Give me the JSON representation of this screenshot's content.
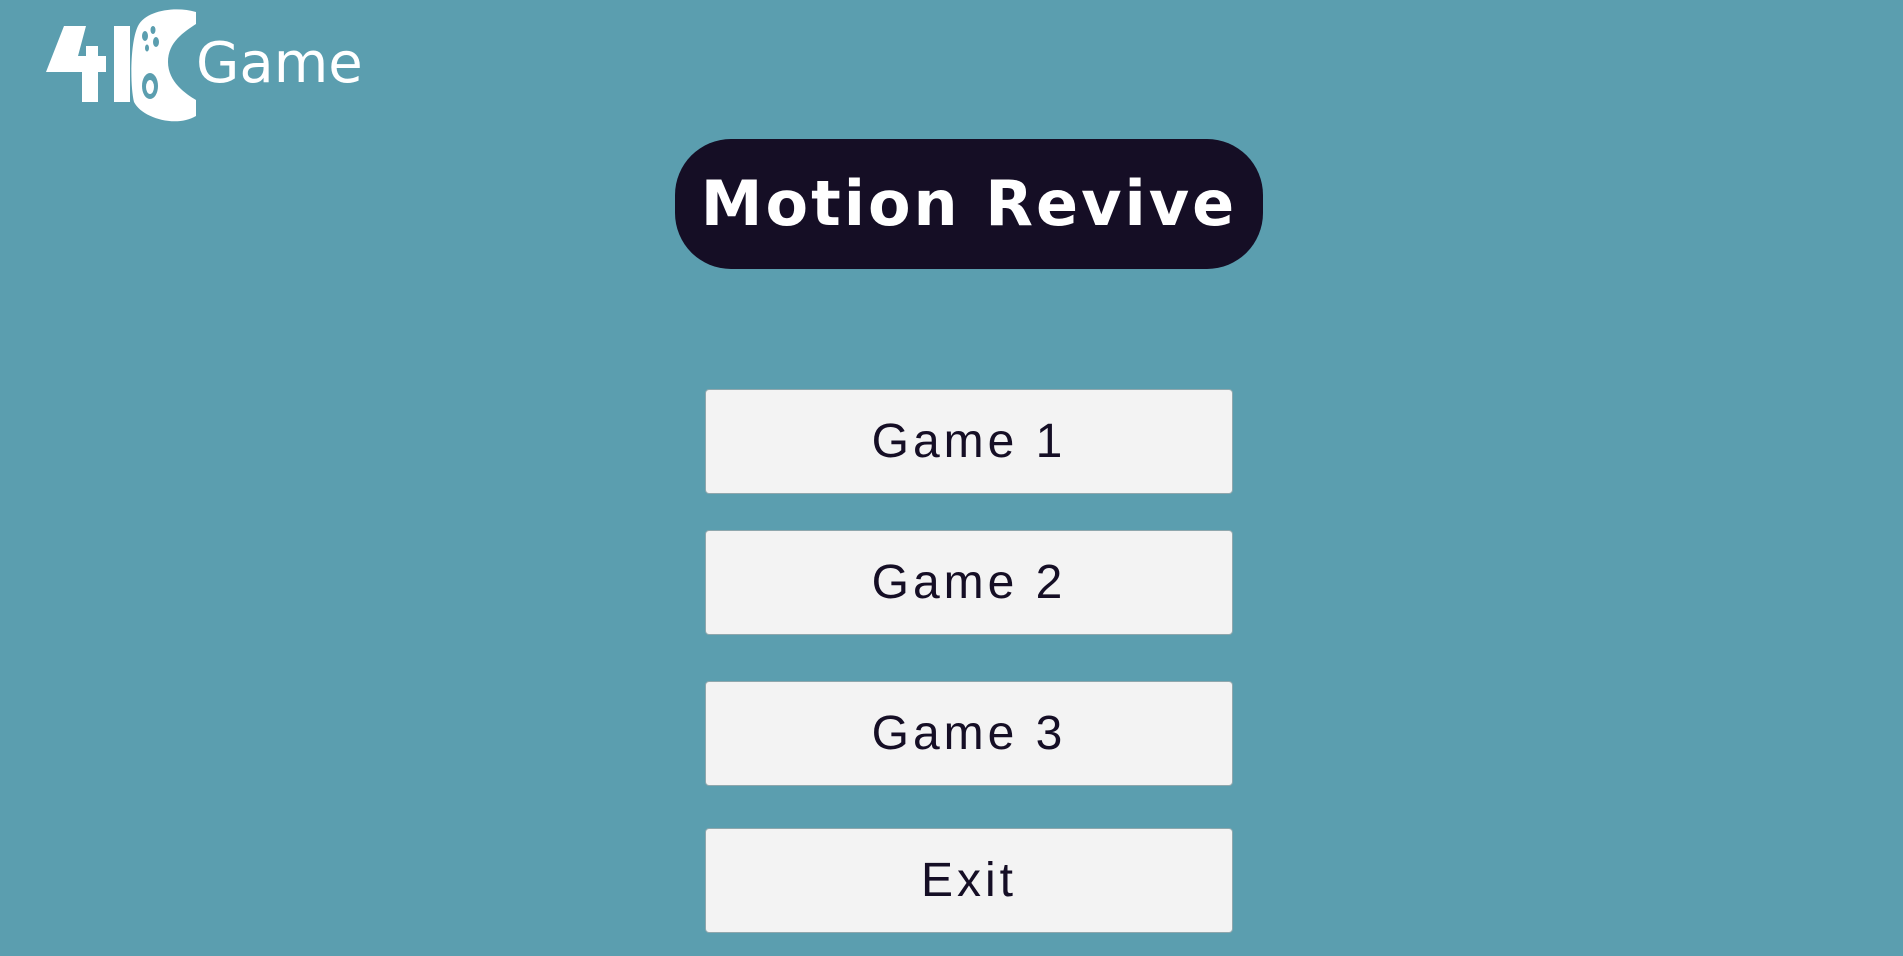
{
  "logo": {
    "mark": "4K",
    "text": "Game"
  },
  "title": "Motion Revive",
  "menu": {
    "buttons": [
      {
        "label": "Game 1"
      },
      {
        "label": "Game 2"
      },
      {
        "label": "Game 3"
      },
      {
        "label": "Exit"
      }
    ]
  },
  "colors": {
    "background": "#5b9eaf",
    "title_bg": "#150e25",
    "title_text": "#ffffff",
    "button_bg": "#f3f3f3",
    "button_text": "#150e25"
  },
  "icons": {
    "logo_icon": "gamepad-icon"
  }
}
